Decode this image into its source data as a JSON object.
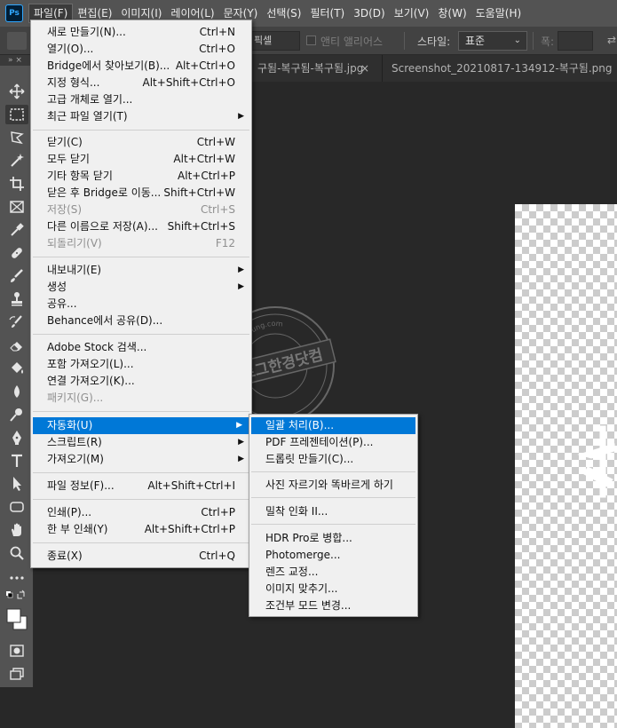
{
  "menubar": {
    "logo": "Ps",
    "items": [
      "파일(F)",
      "편집(E)",
      "이미지(I)",
      "레이어(L)",
      "문자(Y)",
      "선택(S)",
      "필터(T)",
      "3D(D)",
      "보기(V)",
      "창(W)",
      "도움말(H)"
    ]
  },
  "options": {
    "feather_value": "픽셀",
    "anti_alias": "앤티 앨리어스",
    "style_label": "스타일:",
    "style_value": "표준",
    "width_label": "폭:",
    "swap": "⇄"
  },
  "toolbar_header": "» ×",
  "tabs": {
    "tab1": "구됨-복구됨-복구됨.jpg",
    "tab1_close": "×",
    "tab2": "Screenshot_20210817-134912-복구됨.png"
  },
  "file_menu": {
    "items": [
      {
        "label": "새로 만들기(N)...",
        "shortcut": "Ctrl+N"
      },
      {
        "label": "열기(O)...",
        "shortcut": "Ctrl+O"
      },
      {
        "label": "Bridge에서 찾아보기(B)...",
        "shortcut": "Alt+Ctrl+O"
      },
      {
        "label": "지정 형식...",
        "shortcut": "Alt+Shift+Ctrl+O"
      },
      {
        "label": "고급 개체로 열기...",
        "shortcut": ""
      },
      {
        "label": "최근 파일 열기(T)",
        "shortcut": ""
      },
      {
        "label": "닫기(C)",
        "shortcut": "Ctrl+W"
      },
      {
        "label": "모두 닫기",
        "shortcut": "Alt+Ctrl+W"
      },
      {
        "label": "기타 항목 닫기",
        "shortcut": "Alt+Ctrl+P"
      },
      {
        "label": "닫은 후 Bridge로 이동...",
        "shortcut": "Shift+Ctrl+W"
      },
      {
        "label": "저장(S)",
        "shortcut": "Ctrl+S"
      },
      {
        "label": "다른 이름으로 저장(A)...",
        "shortcut": "Shift+Ctrl+S"
      },
      {
        "label": "되돌리기(V)",
        "shortcut": "F12"
      },
      {
        "label": "내보내기(E)",
        "shortcut": ""
      },
      {
        "label": "생성",
        "shortcut": ""
      },
      {
        "label": "공유...",
        "shortcut": ""
      },
      {
        "label": "Behance에서 공유(D)...",
        "shortcut": ""
      },
      {
        "label": "Adobe Stock 검색...",
        "shortcut": ""
      },
      {
        "label": "포함 가져오기(L)...",
        "shortcut": ""
      },
      {
        "label": "연결 가져오기(K)...",
        "shortcut": ""
      },
      {
        "label": "패키지(G)...",
        "shortcut": ""
      },
      {
        "label": "자동화(U)",
        "shortcut": ""
      },
      {
        "label": "스크립트(R)",
        "shortcut": ""
      },
      {
        "label": "가져오기(M)",
        "shortcut": ""
      },
      {
        "label": "파일 정보(F)...",
        "shortcut": "Alt+Shift+Ctrl+I"
      },
      {
        "label": "인쇄(P)...",
        "shortcut": "Ctrl+P"
      },
      {
        "label": "한 부 인쇄(Y)",
        "shortcut": "Alt+Shift+Ctrl+P"
      },
      {
        "label": "종료(X)",
        "shortcut": "Ctrl+Q"
      }
    ]
  },
  "automate_menu": {
    "items": [
      "일괄 처리(B)...",
      "PDF 프레젠테이션(P)...",
      "드롭릿 만들기(C)...",
      "사진 자르기와 똑바르게 하기",
      "밀착 인화 II...",
      "HDR Pro로 병합...",
      "Photomerge...",
      "렌즈 교정...",
      "이미지 맞추기...",
      "조건부 모드 변경..."
    ]
  },
  "watermark": {
    "main": "블로그한경닷컴",
    "ring": "blog.hankyung.com"
  },
  "colors": {
    "highlight": "#0078d7",
    "menubar": "#535353",
    "canvas": "#282828"
  }
}
